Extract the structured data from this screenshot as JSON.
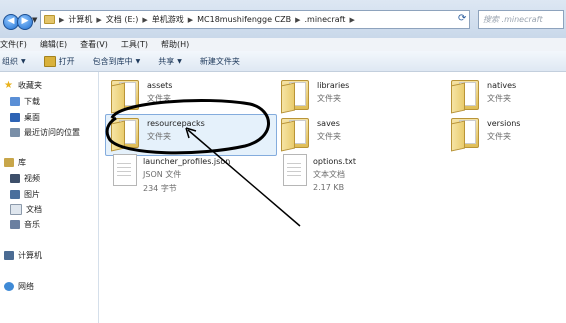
{
  "address_bar": {
    "path": [
      "计算机",
      "文档 (E:)",
      "单机游戏",
      "MC18mushifengge CZB",
      ".minecraft"
    ],
    "search_placeholder": "搜索 .minecraft"
  },
  "menu": [
    "文件(F)",
    "编辑(E)",
    "查看(V)",
    "工具(T)",
    "帮助(H)"
  ],
  "toolbar": [
    "组织",
    "打开",
    "包含到库中",
    "共享",
    "新建文件夹"
  ],
  "sidebar": {
    "favorites_title": "收藏夹",
    "favorites": [
      "下载",
      "桌面",
      "最近访问的位置"
    ],
    "library_title": "库",
    "library": [
      "视频",
      "图片",
      "文档",
      "音乐"
    ],
    "computer": "计算机",
    "network": "网络"
  },
  "items": [
    {
      "name": "assets",
      "type": "文件夹",
      "size": ""
    },
    {
      "name": "libraries",
      "type": "文件夹",
      "size": ""
    },
    {
      "name": "natives",
      "type": "文件夹",
      "size": ""
    },
    {
      "name": "resourcepacks",
      "type": "文件夹",
      "size": ""
    },
    {
      "name": "saves",
      "type": "文件夹",
      "size": ""
    },
    {
      "name": "versions",
      "type": "文件夹",
      "size": ""
    },
    {
      "name": "launcher_profiles.json",
      "type": "JSON 文件",
      "size": "234 字节"
    },
    {
      "name": "options.txt",
      "type": "文本文档",
      "size": "2.17 KB"
    }
  ]
}
